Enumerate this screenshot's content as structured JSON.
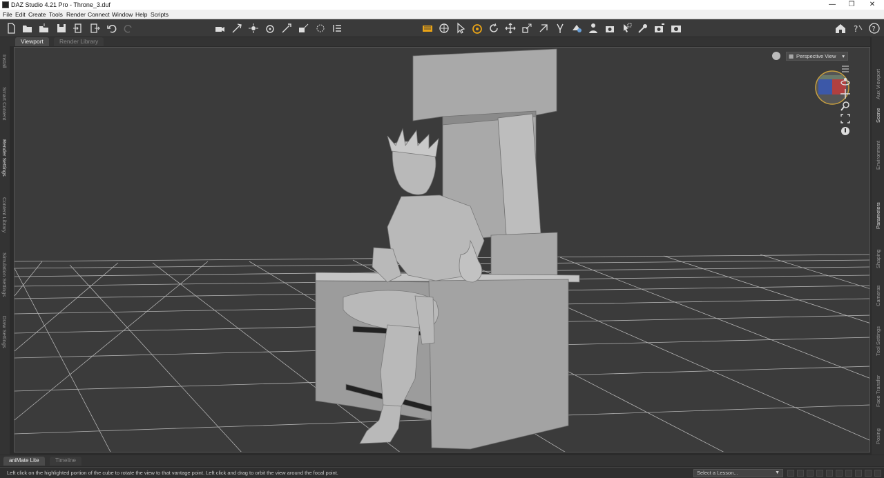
{
  "window": {
    "title": "DAZ Studio 4.21 Pro - Throne_3.duf",
    "minimize": "—",
    "restore": "❐",
    "close": "✕"
  },
  "menu": [
    "File",
    "Edit",
    "Create",
    "Tools",
    "Render",
    "Connect",
    "Window",
    "Help",
    "Scripts"
  ],
  "tabs": {
    "viewport": "Viewport",
    "render_library": "Render Library"
  },
  "left_panes": [
    "Install",
    "Smart Content",
    "Render Settings",
    "Content Library",
    "Simulation Settings",
    "Draw Settings"
  ],
  "right_panes": [
    "Aux Viewport",
    "Scene",
    "Environment",
    "Parameters",
    "Shaping",
    "Cameras",
    "Tool Settings",
    "Face Transfer",
    "Posing"
  ],
  "view": {
    "camera": "Perspective View"
  },
  "bottom_tabs": {
    "animate": "aniMate Lite",
    "timeline": "Timeline"
  },
  "status": {
    "message": "Left click on the highlighted portion of the cube to rotate the view to that vantage point. Left click and drag to orbit the view around the focal point.",
    "lesson": "Select a Lesson..."
  },
  "colors": {
    "viewport_bg": "#3b3b3b",
    "grid_line": "#c8c8c8",
    "model": "#a9a9a9",
    "accent": "#e8a317"
  },
  "icons": [
    "new-file-icon",
    "open-icon",
    "merge-icon",
    "save-icon",
    "import-icon",
    "export-icon",
    "undo-icon",
    "redo-icon",
    "create-camera-icon",
    "create-light-icon",
    "render-icon",
    "pose-icon",
    "node-select-icon",
    "rotate-icon",
    "translate-icon",
    "scale-icon",
    "universal-tool-icon",
    "home-icon",
    "whats-this-icon",
    "help-icon"
  ]
}
